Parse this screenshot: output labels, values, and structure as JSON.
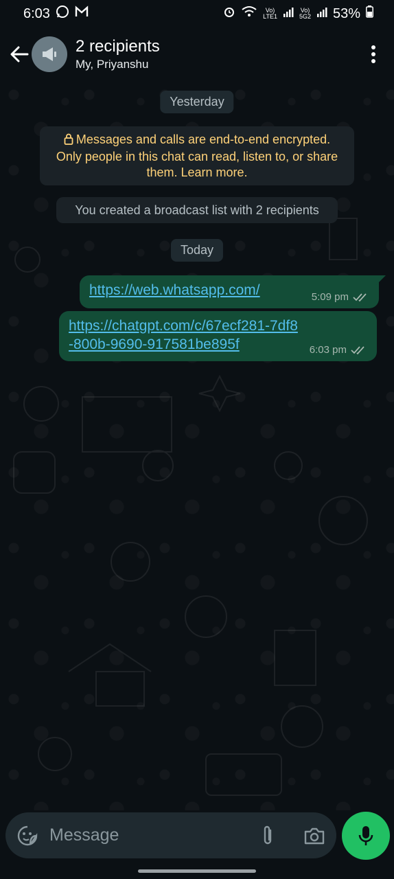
{
  "status_bar": {
    "time": "6:03",
    "battery": "53%",
    "net1_top": "Vo)",
    "net1_bottom": "LTE1",
    "net2_top": "Vo)",
    "net2_bottom": "5G2"
  },
  "header": {
    "title": "2 recipients",
    "subtitle": "My, Priyanshu",
    "icons": [
      "back-arrow-icon",
      "broadcast-icon",
      "more-vert-icon"
    ]
  },
  "chat": {
    "date_yesterday": "Yesterday",
    "encryption_notice": "Messages and calls are end-to-end encrypted. Only people in this chat can read, listen to, or share them. Learn more.",
    "system_message": "You created a broadcast list with 2 recipients",
    "date_today": "Today",
    "messages": [
      {
        "text": "https://web.whatsapp.com/",
        "time": "5:09 pm",
        "status": "read-double-tick"
      },
      {
        "text_line1": "https://chatgpt.com/c/67ecf281-7df8",
        "text_line2": "-800b-9690-917581be895f",
        "time": "6:03 pm",
        "status": "read-double-tick"
      }
    ]
  },
  "composer": {
    "placeholder": "Message",
    "icons": [
      "sticker-icon",
      "attach-icon",
      "camera-icon",
      "mic-icon"
    ]
  },
  "colors": {
    "background": "#0b1014",
    "outgoing_bubble": "#134d37",
    "link": "#53bdeb",
    "encryption_text": "#ffd279",
    "mic_button": "#21c063"
  }
}
